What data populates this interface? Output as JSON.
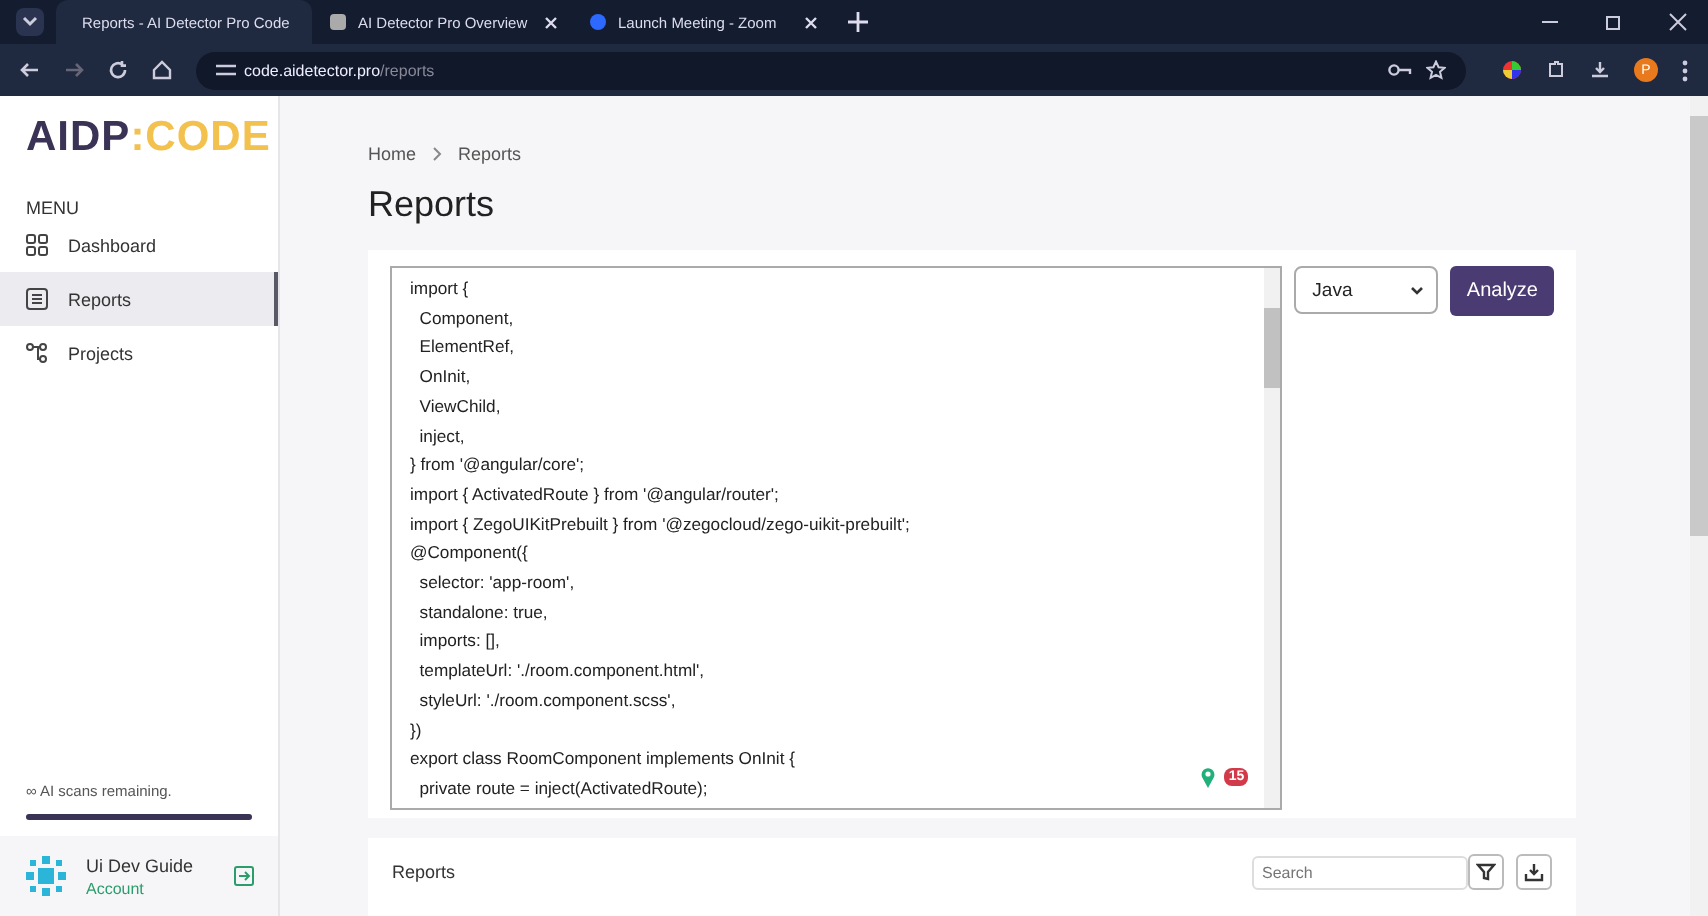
{
  "browser": {
    "tabs": [
      {
        "title": "Reports - AI Detector Pro Code",
        "selected": true
      },
      {
        "title": "AI Detector Pro Overview",
        "selected": false
      },
      {
        "title": "Launch Meeting - Zoom",
        "selected": false
      }
    ],
    "url_host": "code.aidetector.pro",
    "url_path": "/reports",
    "profile_initial": "P"
  },
  "sidebar": {
    "logo_left": "AIDP",
    "logo_colon": ":",
    "logo_right": "CODE",
    "menu_heading": "MENU",
    "items": [
      {
        "label": "Dashboard",
        "selected": false
      },
      {
        "label": "Reports",
        "selected": true
      },
      {
        "label": "Projects",
        "selected": false
      }
    ],
    "scans_text": "∞ AI scans remaining.",
    "scans_meter": {
      "level": 1
    },
    "account": {
      "name": "Ui Dev Guide",
      "role": "Account"
    }
  },
  "breadcrumb": [
    "Home",
    "Reports"
  ],
  "page_title": "Reports",
  "editor": {
    "code": "import {\n  Component,\n  ElementRef,\n  OnInit,\n  ViewChild,\n  inject,\n} from '@angular/core';\nimport { ActivatedRoute } from '@angular/router';\nimport { ZegoUIKitPrebuilt } from '@zegocloud/zego-uikit-prebuilt';\n@Component({\n  selector: 'app-room',\n  standalone: true,\n  imports: [],\n  templateUrl: './room.component.html',\n  styleUrl: './room.component.scss',\n})\nexport class RoomComponent implements OnInit {\n  private route = inject(ActivatedRoute);",
    "badge_count": "15"
  },
  "language_select": {
    "value": "Java"
  },
  "analyze_button": "Analyze",
  "reports_panel": {
    "title": "Reports",
    "search_placeholder": "Search"
  }
}
